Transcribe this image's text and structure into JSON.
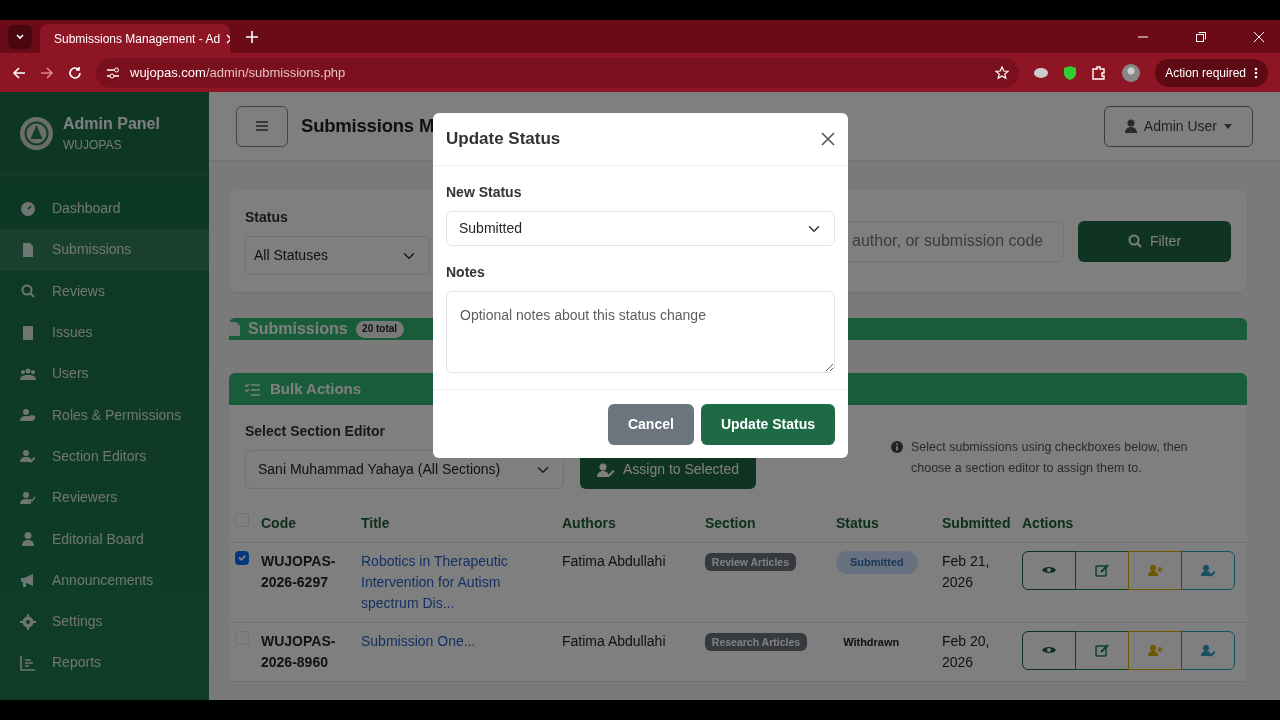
{
  "browser": {
    "tab_title": "Submissions Management - Ad",
    "url_host": "wujopas.com",
    "url_path": "/admin/submissions.php",
    "action_button": "Action required"
  },
  "sidebar": {
    "title": "Admin Panel",
    "subtitle": "WUJOPAS",
    "items": [
      {
        "label": "Dashboard",
        "selected": false
      },
      {
        "label": "Submissions",
        "selected": true
      },
      {
        "label": "Reviews",
        "selected": false
      },
      {
        "label": "Issues",
        "selected": false
      },
      {
        "label": "Users",
        "selected": false
      },
      {
        "label": "Roles & Permissions",
        "selected": false
      },
      {
        "label": "Section Editors",
        "selected": false
      },
      {
        "label": "Reviewers",
        "selected": false
      },
      {
        "label": "Editorial Board",
        "selected": false
      },
      {
        "label": "Announcements",
        "selected": false
      },
      {
        "label": "Settings",
        "selected": false
      },
      {
        "label": "Reports",
        "selected": false
      }
    ]
  },
  "topbar": {
    "page_title": "Submissions M",
    "user_menu": "Admin User"
  },
  "filters": {
    "status_label": "Status",
    "status_value": "All Statuses",
    "search_placeholder": "author, or submission code",
    "filter_button": "Filter"
  },
  "submissions_header": {
    "title": "Submissions",
    "count": "20 total"
  },
  "bulk_actions": {
    "title": "Bulk Actions",
    "editor_label": "Select Section Editor",
    "editor_value": "Sani Muhammad Yahaya (All Sections)",
    "assign_button": "Assign to Selected",
    "hint": "Select submissions using checkboxes below, then choose a section editor to assign them to."
  },
  "table": {
    "select_all_checked": false,
    "columns": [
      "Code",
      "Title",
      "Authors",
      "Section",
      "Status",
      "Submitted",
      "Actions"
    ],
    "rows": [
      {
        "checked": true,
        "code": "WUJOPAS-2026-6297",
        "title": "Robotics in Therapeutic Intervention for Autism spectrum Dis...",
        "authors": "Fatima Abdullahi",
        "section": "Review Articles",
        "status": "Submitted",
        "status_pill": true,
        "submitted": "Feb 21, 2026"
      },
      {
        "checked": false,
        "code": "WUJOPAS-2026-8960",
        "title": "Submission One...",
        "authors": "Fatima Abdullahi",
        "section": "Research Articles",
        "status": "Withdrawn",
        "status_pill": false,
        "submitted": "Feb 20, 2026"
      }
    ]
  },
  "modal": {
    "title": "Update Status",
    "status_label": "New Status",
    "status_value": "Submitted",
    "notes_label": "Notes",
    "notes_placeholder": "Optional notes about this status change",
    "buttons": [
      {
        "label": "Cancel",
        "kind": "secondary"
      },
      {
        "label": "Update Status",
        "kind": "primary"
      }
    ]
  }
}
